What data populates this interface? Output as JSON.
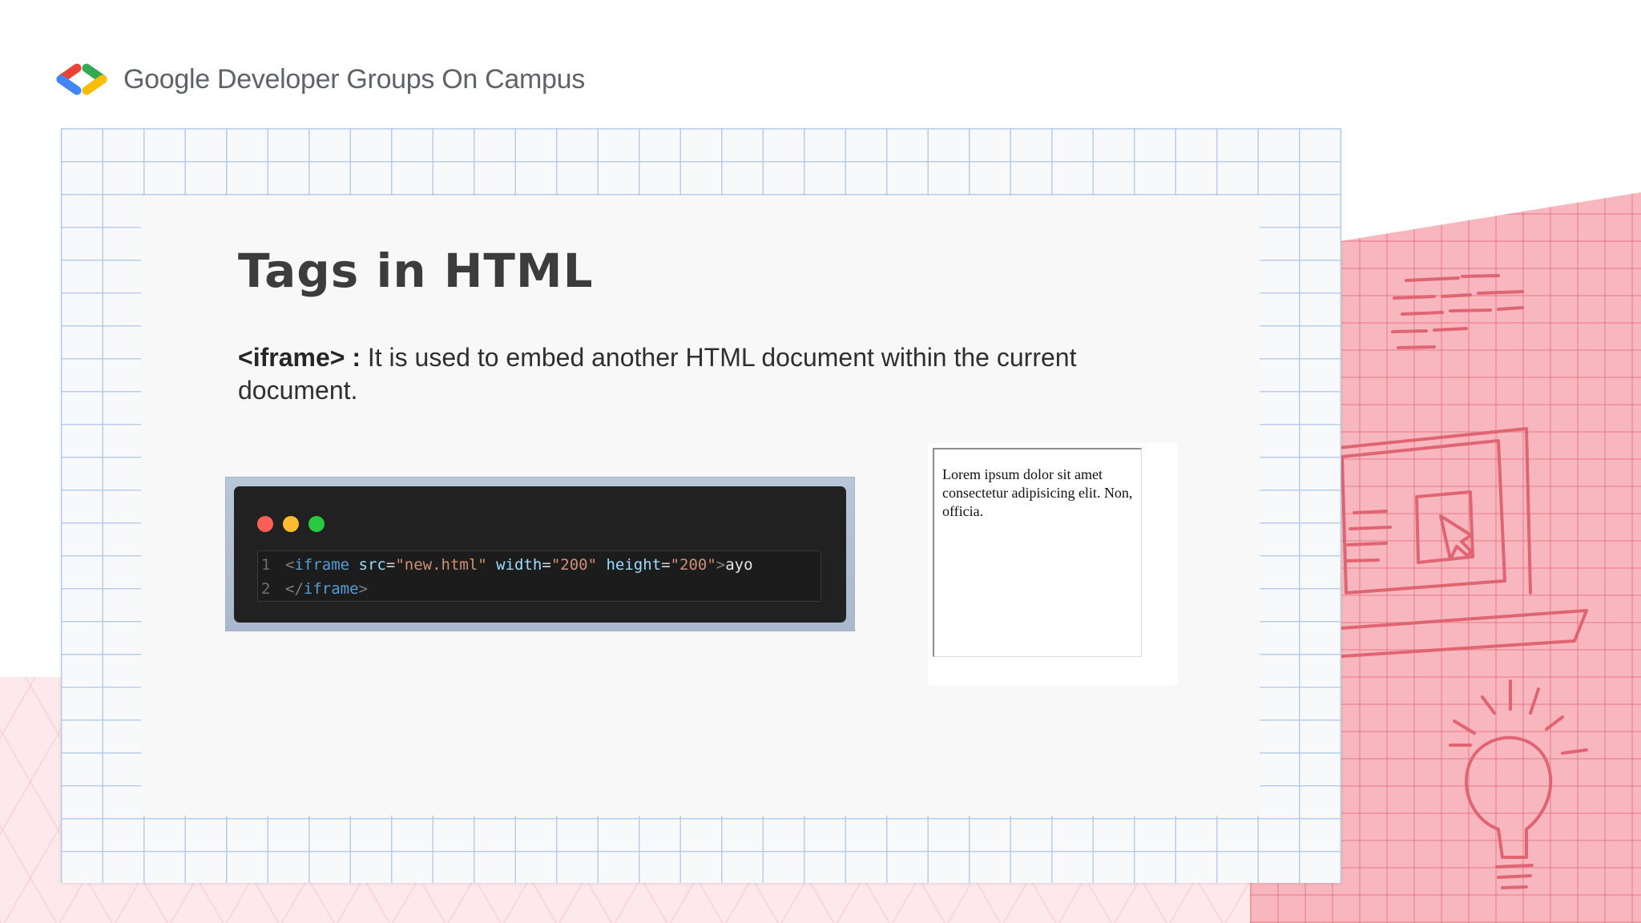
{
  "header": {
    "brand_text": "Google Developer Groups On Campus",
    "logo_icon": "gdg-chevron-logo"
  },
  "slide": {
    "title": "Tags in HTML",
    "description": {
      "tag": "<iframe> :",
      "text": " It is used to embed another HTML document within the current document."
    },
    "code": {
      "window_dots": [
        "#ff5f57",
        "#febc2e",
        "#28c840"
      ],
      "lines": [
        {
          "number": "1",
          "open_bracket": "<",
          "tag": "iframe",
          "attr1": "src",
          "val1": "\"new.html\"",
          "attr2": "width",
          "val2": "\"200\"",
          "attr3": "height",
          "val3": "\"200\"",
          "close": ">",
          "text": "ayo"
        },
        {
          "number": "2",
          "open_bracket": "</",
          "tag": "iframe",
          "close": ">"
        }
      ]
    },
    "preview": {
      "text": "Lorem ipsum dolor sit amet consectetur adipisicing elit. Non, officia."
    }
  },
  "colors": {
    "accent_pink": "#f8b7bf",
    "grid_blue": "#adc6e8",
    "title_gray": "#3c3c3c"
  }
}
